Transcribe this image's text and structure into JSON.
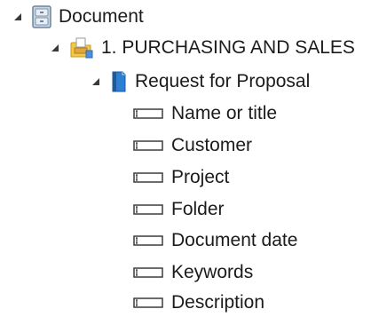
{
  "tree": {
    "root": {
      "label": "Document",
      "icon": "cabinet-icon",
      "expanded": true
    },
    "category": {
      "label": "1. PURCHASING AND SALES",
      "icon": "folder-icon",
      "expanded": true
    },
    "doctype": {
      "label": "Request for Proposal",
      "icon": "book-icon",
      "expanded": true
    },
    "fields": [
      {
        "label": "Name or title",
        "icon": "field-icon"
      },
      {
        "label": "Customer",
        "icon": "field-icon"
      },
      {
        "label": "Project",
        "icon": "field-icon"
      },
      {
        "label": "Folder",
        "icon": "field-icon"
      },
      {
        "label": "Document date",
        "icon": "field-icon"
      },
      {
        "label": "Keywords",
        "icon": "field-icon"
      },
      {
        "label": "Description",
        "icon": "field-icon"
      }
    ]
  },
  "colors": {
    "text": "#1b1b1b",
    "expander": "#3a3a3a",
    "folder": "#f2c94c",
    "book": "#2d7fd3",
    "cabinet": "#8aa1ba"
  }
}
